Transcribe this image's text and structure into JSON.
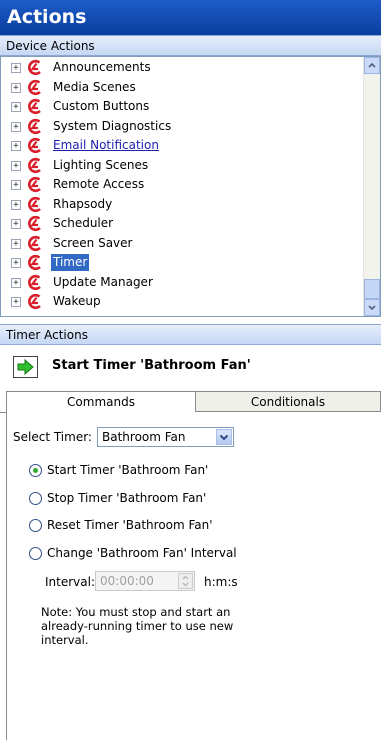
{
  "window": {
    "title": "Actions"
  },
  "device_actions": {
    "header": "Device Actions",
    "items": [
      {
        "label": "Announcements",
        "state": "normal"
      },
      {
        "label": "Media Scenes",
        "state": "normal"
      },
      {
        "label": "Custom Buttons",
        "state": "normal"
      },
      {
        "label": "System Diagnostics",
        "state": "normal"
      },
      {
        "label": "Email Notification",
        "state": "link"
      },
      {
        "label": "Lighting Scenes",
        "state": "normal"
      },
      {
        "label": "Remote Access",
        "state": "normal"
      },
      {
        "label": "Rhapsody",
        "state": "normal"
      },
      {
        "label": "Scheduler",
        "state": "normal"
      },
      {
        "label": "Screen Saver",
        "state": "normal"
      },
      {
        "label": "Timer",
        "state": "selected"
      },
      {
        "label": "Update Manager",
        "state": "normal"
      },
      {
        "label": "Wakeup",
        "state": "normal"
      }
    ],
    "expander_glyph": "+",
    "item_icon": "brand-logo-icon"
  },
  "timer_actions": {
    "header": "Timer Actions",
    "current_action": "Start Timer 'Bathroom Fan'",
    "current_action_icon": "green-arrow-icon"
  },
  "tabs": [
    {
      "label": "Commands",
      "active": true
    },
    {
      "label": "Conditionals",
      "active": false
    }
  ],
  "commands": {
    "select_label": "Select Timer:",
    "select_value": "Bathroom Fan",
    "options": [
      {
        "label": "Start Timer 'Bathroom Fan'",
        "checked": true
      },
      {
        "label": "Stop Timer 'Bathroom Fan'",
        "checked": false
      },
      {
        "label": "Reset Timer 'Bathroom Fan'",
        "checked": false
      },
      {
        "label": "Change 'Bathroom Fan' Interval",
        "checked": false
      }
    ],
    "interval_label": "Interval:",
    "interval_value": "00:00:00",
    "interval_unit": "h:m:s",
    "note": "Note: You must stop and start an already-running timer to use new interval."
  },
  "colors": {
    "title_bar": "#0a3e9e",
    "selection": "#316ac5",
    "link": "#1f1fb0",
    "logo": "#d81e2a",
    "arrow": "#2fbf2f"
  }
}
